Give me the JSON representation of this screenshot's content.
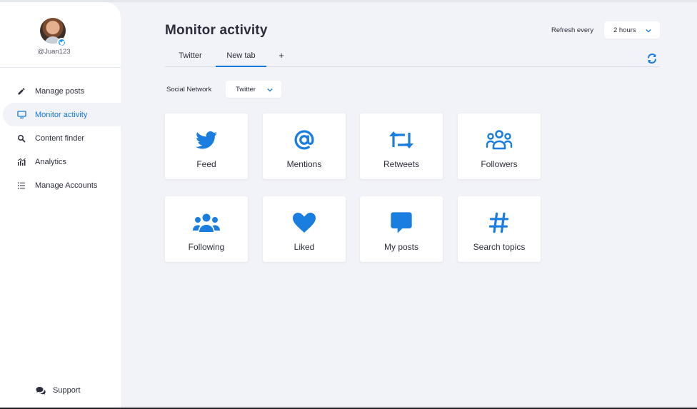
{
  "profile": {
    "username": "@Juan123"
  },
  "nav": {
    "items": [
      {
        "label": "Manage posts",
        "icon": "pencil-icon"
      },
      {
        "label": "Monitor activity",
        "icon": "monitor-icon",
        "active": true
      },
      {
        "label": "Content finder",
        "icon": "search-icon"
      },
      {
        "label": "Analytics",
        "icon": "analytics-chart-icon"
      },
      {
        "label": "Manage Accounts",
        "icon": "list-icon"
      }
    ],
    "support_label": "Support"
  },
  "header": {
    "title": "Monitor activity",
    "refresh_label": "Refresh every",
    "refresh_value": "2 hours"
  },
  "tabs": [
    {
      "label": "Twitter"
    },
    {
      "label": "New tab",
      "active": true
    },
    {
      "label": "+"
    }
  ],
  "filter": {
    "label": "Social Network",
    "value": "Twitter"
  },
  "cards": [
    {
      "label": "Feed",
      "icon": "twitter-bird-icon"
    },
    {
      "label": "Mentions",
      "icon": "at-sign-icon"
    },
    {
      "label": "Retweets",
      "icon": "retweet-icon"
    },
    {
      "label": "Followers",
      "icon": "followers-icon"
    },
    {
      "label": "Following",
      "icon": "users-group-icon"
    },
    {
      "label": "Liked",
      "icon": "heart-icon"
    },
    {
      "label": "My posts",
      "icon": "message-icon"
    },
    {
      "label": "Search topics",
      "icon": "hashtag-icon"
    }
  ],
  "colors": {
    "accent": "#1377d8",
    "icon_blue": "#1a7de0",
    "background": "#f2f3f8",
    "text": "#2b2d3b"
  }
}
